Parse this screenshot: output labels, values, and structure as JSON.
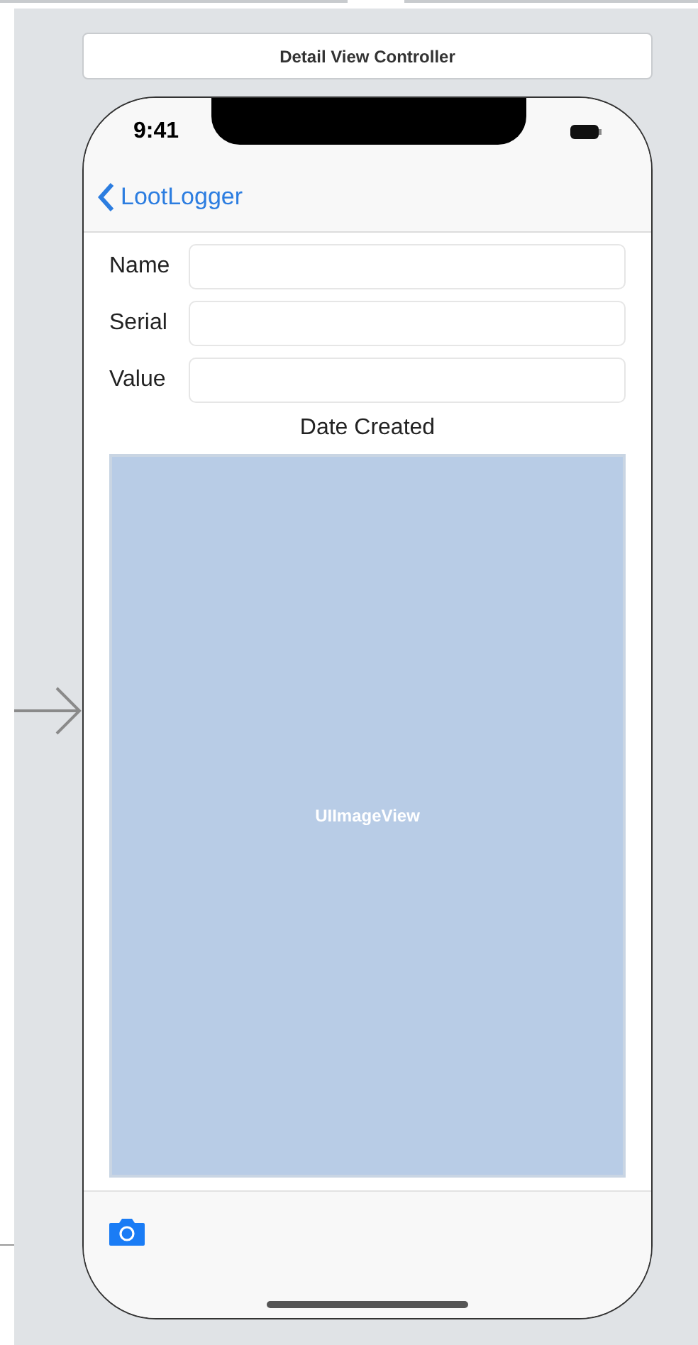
{
  "scene_title": "Detail View Controller",
  "status_bar": {
    "time": "9:41"
  },
  "nav_bar": {
    "back_label": "LootLogger"
  },
  "fields": [
    {
      "label": "Name"
    },
    {
      "label": "Serial"
    },
    {
      "label": "Value"
    }
  ],
  "date_label": "Date Created",
  "image_view": {
    "label": "UIImageView"
  }
}
